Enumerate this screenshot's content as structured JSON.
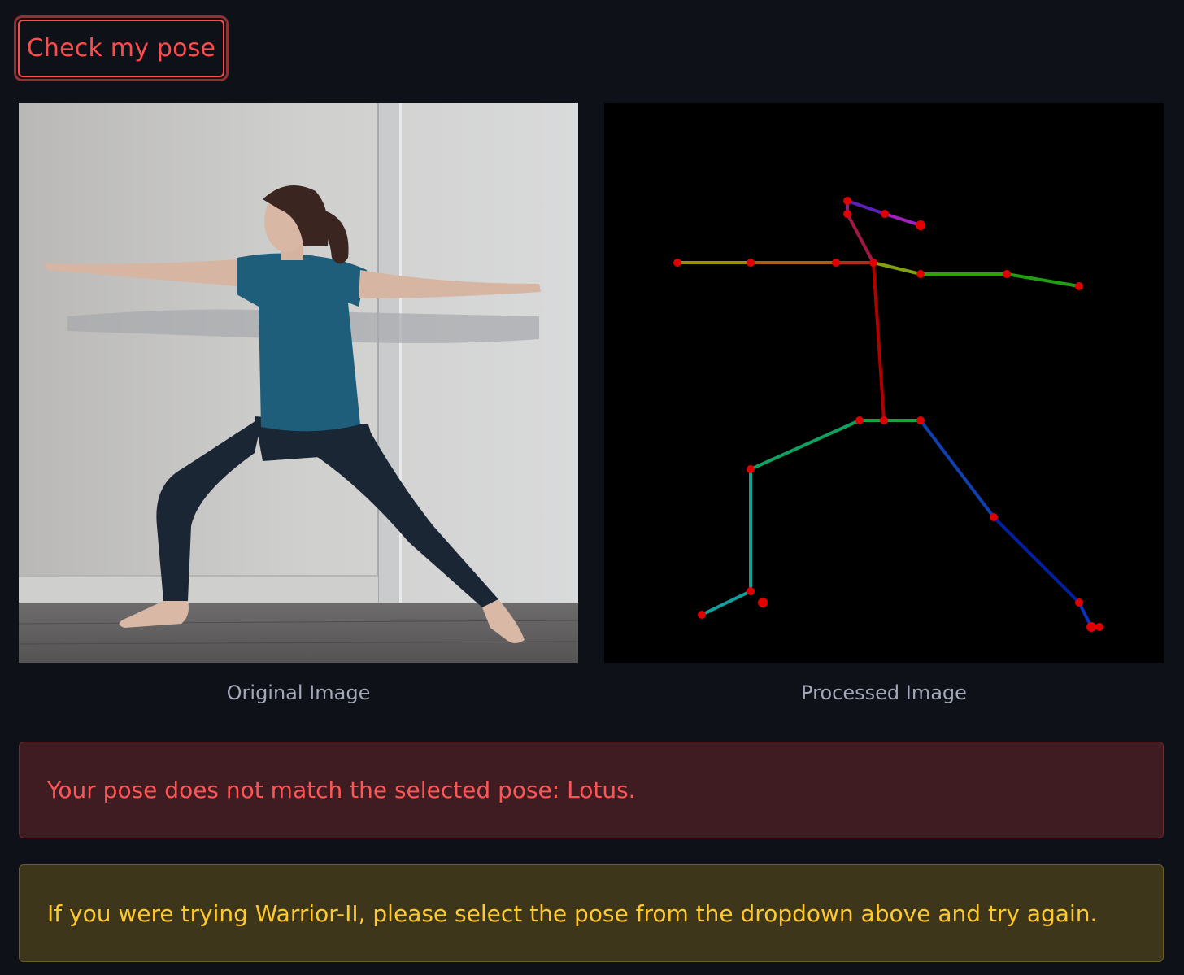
{
  "button": {
    "check_label": "Check my pose",
    "accent_color": "#ff4b4b"
  },
  "images": {
    "original_caption": "Original Image",
    "processed_caption": "Processed Image"
  },
  "alerts": {
    "error_text": "Your pose does not match the selected pose: Lotus.",
    "warning_text": "If you were trying Warrior-II, please select the pose from the dropdown above and try again.",
    "error_color": "#ff5555",
    "warning_color": "#ffc82c"
  }
}
